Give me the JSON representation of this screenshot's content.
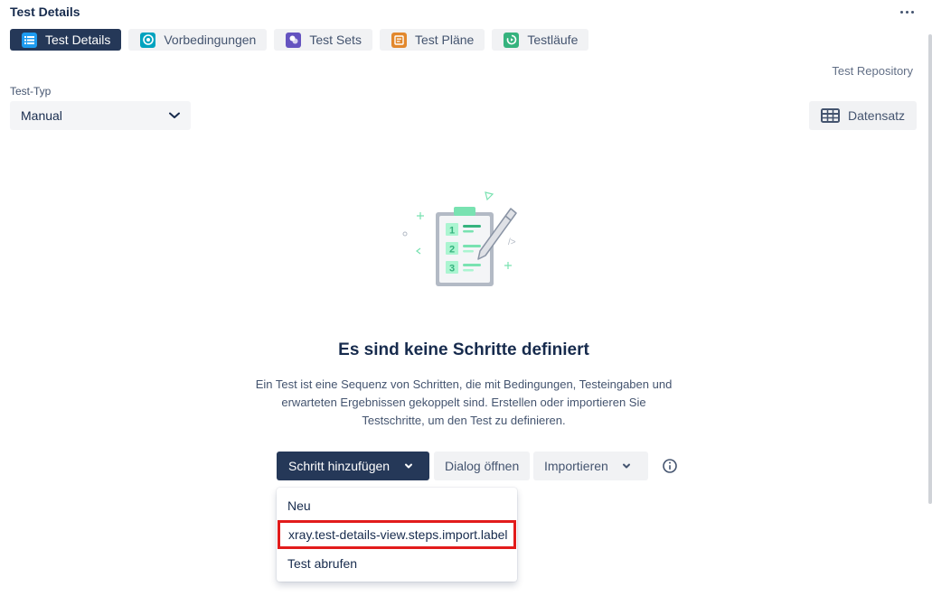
{
  "header": {
    "title": "Test Details",
    "more_icon": "more-horizontal-icon"
  },
  "tabs": [
    {
      "label": "Test Details",
      "icon": "list-icon",
      "color": "#1d9bf0",
      "active": true
    },
    {
      "label": "Vorbedingungen",
      "icon": "precondition-icon",
      "color": "#00a3bf",
      "active": false
    },
    {
      "label": "Test Sets",
      "icon": "test-sets-icon",
      "color": "#6554c0",
      "active": false
    },
    {
      "label": "Test Pläne",
      "icon": "test-plan-icon",
      "color": "#e2882d",
      "active": false
    },
    {
      "label": "Testläufe",
      "icon": "test-run-icon",
      "color": "#36b37e",
      "active": false
    }
  ],
  "repository_link": "Test Repository",
  "test_type": {
    "label": "Test-Typ",
    "value": "Manual"
  },
  "dataset_button": {
    "label": "Datensatz",
    "icon": "table-icon"
  },
  "empty_state": {
    "title": "Es sind keine Schritte definiert",
    "description": "Ein Test ist eine Sequenz von Schritten, die mit Bedingungen, Testeingaben und erwarteten Ergebnissen gekoppelt sind. Erstellen oder importieren Sie Testschritte, um den Test zu definieren.",
    "illustration_icon": "clipboard-checklist-icon",
    "steps": [
      "1",
      "2",
      "3"
    ],
    "code_mark": "/>"
  },
  "actions": {
    "add_step": "Schritt hinzufügen",
    "open_dialog": "Dialog öffnen",
    "import": "Importieren",
    "info_icon": "info-icon"
  },
  "dropdown": {
    "items": [
      {
        "label": "Neu",
        "highlighted": false
      },
      {
        "label": "xray.test-details-view.steps.import.label",
        "highlighted": true
      },
      {
        "label": "Test abrufen",
        "highlighted": false
      }
    ]
  },
  "colors": {
    "primary": "#253858",
    "highlight": "#e21b1b",
    "accent_green": "#36b37e"
  }
}
